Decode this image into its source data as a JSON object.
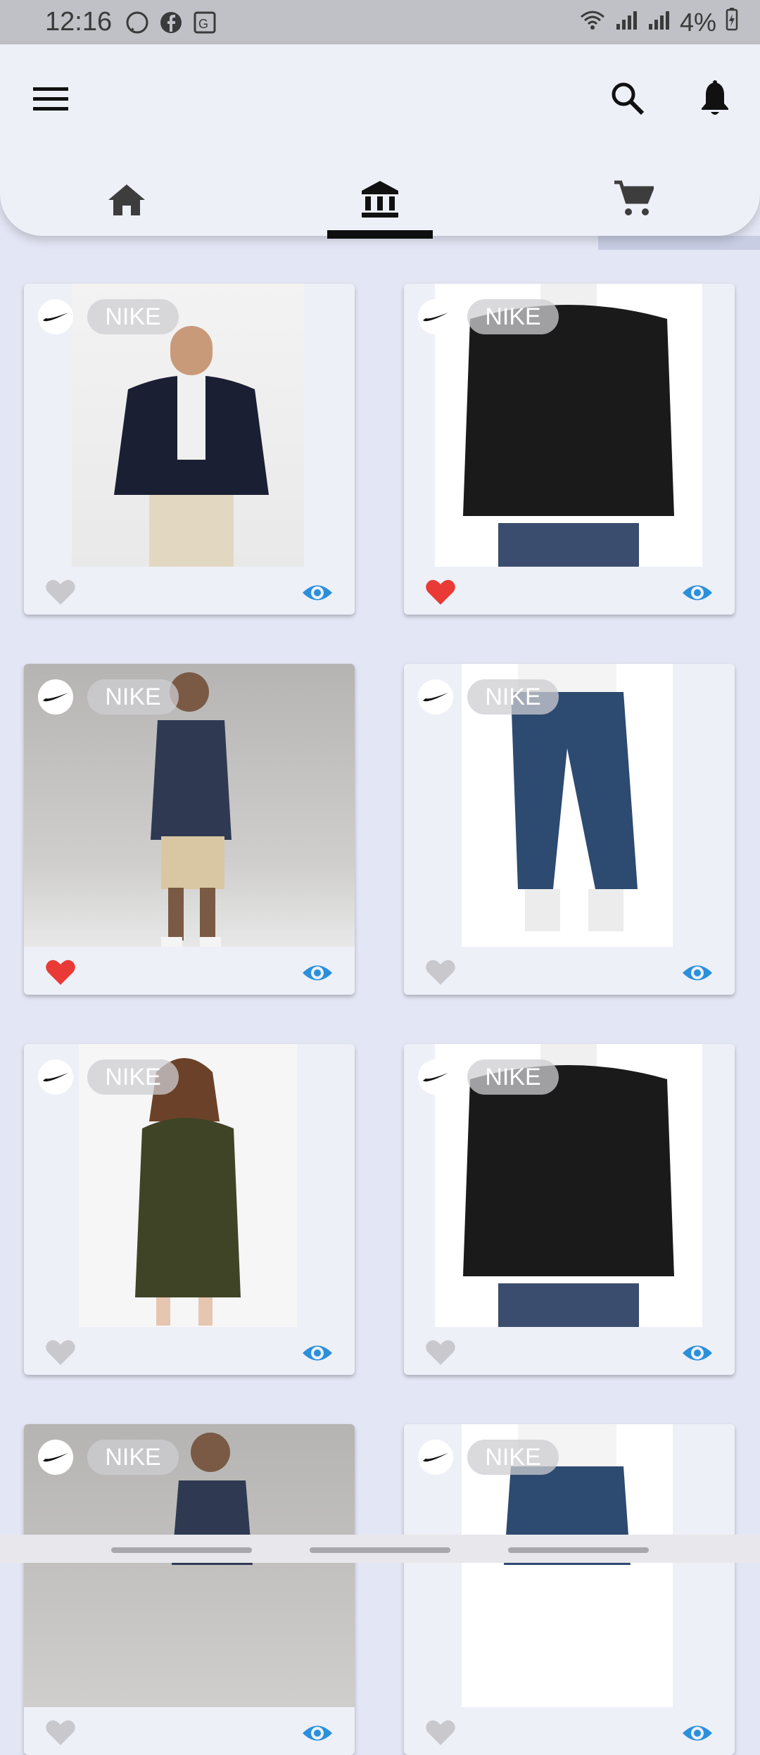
{
  "status_bar": {
    "time": "12:16",
    "battery": "4%"
  },
  "app_bar": {
    "menu_icon": "hamburger-menu-icon",
    "search_icon": "search-icon",
    "notifications_icon": "bell-icon",
    "tabs": [
      {
        "icon": "home-icon",
        "active": false
      },
      {
        "icon": "bank-icon",
        "active": true
      },
      {
        "icon": "cart-icon",
        "active": false
      }
    ]
  },
  "colors": {
    "accent_blue": "#2a90dc",
    "favorite_red": "#ea3a36",
    "unfavorite_gray": "#c9c9cd"
  },
  "products": [
    {
      "brand": "NIKE",
      "favorited": false
    },
    {
      "brand": "NIKE",
      "favorited": true
    },
    {
      "brand": "NIKE",
      "favorited": true
    },
    {
      "brand": "NIKE",
      "favorited": false
    },
    {
      "brand": "NIKE",
      "favorited": false
    },
    {
      "brand": "NIKE",
      "favorited": false
    },
    {
      "brand": "NIKE",
      "favorited": false
    },
    {
      "brand": "NIKE",
      "favorited": false
    }
  ]
}
